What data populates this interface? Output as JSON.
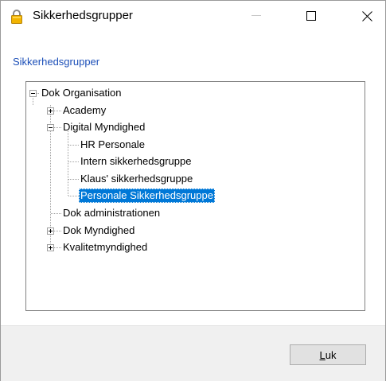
{
  "window": {
    "title": "Sikkerhedsgrupper"
  },
  "section_label": "Sikkerhedsgrupper",
  "tree": {
    "nodes": [
      {
        "label": "Dok Organisation",
        "expander": "minus"
      },
      {
        "label": "Academy",
        "expander": "plus"
      },
      {
        "label": "Digital Myndighed",
        "expander": "minus"
      },
      {
        "label": "HR Personale",
        "expander": "none"
      },
      {
        "label": "Intern sikkerhedsgruppe",
        "expander": "none"
      },
      {
        "label": "Klaus' sikkerhedsgruppe",
        "expander": "none"
      },
      {
        "label": "Personale Sikkerhedsgruppe",
        "expander": "none",
        "selected": true
      },
      {
        "label": "Dok administrationen",
        "expander": "none"
      },
      {
        "label": "Dok Myndighed",
        "expander": "plus"
      },
      {
        "label": "Kvalitetmyndighed",
        "expander": "plus"
      }
    ],
    "selection_color": "#0078d7"
  },
  "footer": {
    "close_button": {
      "accel": "L",
      "rest": "uk"
    }
  },
  "icons": {
    "title": "padlock-icon",
    "minimize": "minimize-icon",
    "maximize": "maximize-icon",
    "close": "close-icon"
  },
  "colors": {
    "section_label": "#1c4fb8",
    "footer_bg": "#f0f0f0"
  }
}
